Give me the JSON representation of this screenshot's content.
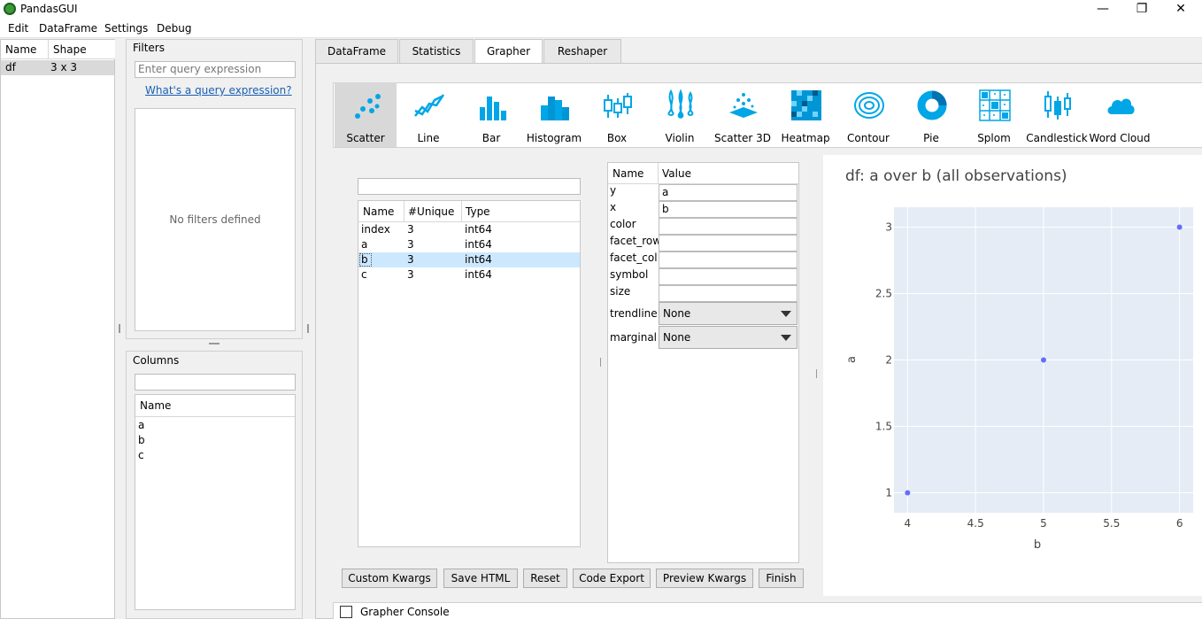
{
  "window": {
    "title": "PandasGUI",
    "minimize": "—",
    "restore": "❐",
    "close": "✕"
  },
  "menu": [
    "Edit",
    "DataFrame",
    "Settings",
    "Debug"
  ],
  "df_list": {
    "headers": [
      "Name",
      "Shape"
    ],
    "rows": [
      {
        "name": "df",
        "shape": "3 x 3"
      }
    ]
  },
  "filters": {
    "title": "Filters",
    "placeholder": "Enter query expression",
    "help_link": "What's a query expression?",
    "empty_text": "No filters defined"
  },
  "columns_panel": {
    "title": "Columns",
    "header": "Name",
    "items": [
      "a",
      "b",
      "c"
    ]
  },
  "tabs": [
    "DataFrame",
    "Statistics",
    "Grapher",
    "Reshaper"
  ],
  "active_tab": "Grapher",
  "plot_types": [
    "Scatter",
    "Line",
    "Bar",
    "Histogram",
    "Box",
    "Violin",
    "Scatter 3D",
    "Heatmap",
    "Contour",
    "Pie",
    "Splom",
    "Candlestick",
    "Word Cloud"
  ],
  "active_plot_type": "Scatter",
  "column_table": {
    "headers": [
      "Name",
      "#Unique",
      "Type"
    ],
    "rows": [
      {
        "name": "index",
        "unique": "3",
        "type": "int64"
      },
      {
        "name": "a",
        "unique": "3",
        "type": "int64"
      },
      {
        "name": "b",
        "unique": "3",
        "type": "int64"
      },
      {
        "name": "c",
        "unique": "3",
        "type": "int64"
      }
    ],
    "selected_row": "b"
  },
  "kwargs_table": {
    "headers": [
      "Name",
      "Value"
    ],
    "rows": [
      {
        "name": "y",
        "value": "a"
      },
      {
        "name": "x",
        "value": "b"
      },
      {
        "name": "color",
        "value": ""
      },
      {
        "name": "facet_row",
        "value": ""
      },
      {
        "name": "facet_col",
        "value": ""
      },
      {
        "name": "symbol",
        "value": ""
      },
      {
        "name": "size",
        "value": ""
      }
    ],
    "combos": [
      {
        "name": "trendline",
        "value": "None"
      },
      {
        "name": "marginal",
        "value": "None"
      }
    ]
  },
  "buttons": [
    "Custom Kwargs",
    "Save HTML",
    "Reset",
    "Code Export",
    "Preview Kwargs",
    "Finish"
  ],
  "console": {
    "label": "Grapher Console",
    "checked": false
  },
  "colors": {
    "plot_bg": "#e5ecf6",
    "marker": "#636efa",
    "selection": "#cce8ff"
  },
  "chart_data": {
    "type": "scatter",
    "title": "df: a  over b (all observations)",
    "xlabel": "b",
    "ylabel": "a",
    "x": [
      4,
      5,
      6
    ],
    "y": [
      1,
      2,
      3
    ],
    "xlim": [
      3.9,
      6.1
    ],
    "ylim": [
      0.85,
      3.15
    ],
    "xticks": [
      4,
      4.5,
      5,
      5.5,
      6
    ],
    "yticks": [
      1,
      1.5,
      2,
      2.5,
      3
    ],
    "xtick_labels": [
      "4",
      "4.5",
      "5",
      "5.5",
      "6"
    ],
    "ytick_labels": [
      "1",
      "1.5",
      "2",
      "2.5",
      "3"
    ],
    "grid": true
  }
}
